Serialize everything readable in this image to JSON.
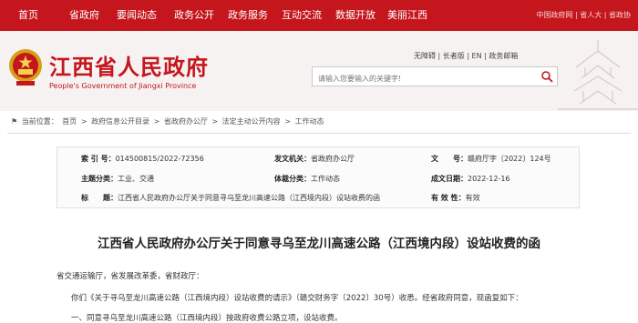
{
  "topnav": {
    "items": [
      "首页",
      "省政府",
      "要闻动态",
      "政务公开",
      "政务服务",
      "互动交流",
      "数据开放",
      "美丽江西"
    ],
    "right_links": "中国政府网 | 省人大 | 省政协"
  },
  "header": {
    "site_name": "江西省人民政府",
    "site_name_en": "People's Government of Jiangxi Province",
    "top_links": "无障碍 | 长者版 | EN | 政务邮箱",
    "search_placeholder": "请输入您要输入的关键字!",
    "emblem_icon": "national-emblem-icon",
    "accent_color": "#c4161c"
  },
  "breadcrumb": {
    "prefix": "当前位置：",
    "items": [
      "首页",
      "政府信息公开目录",
      "省政府办公厅",
      "法定主动公开内容",
      "工作动态"
    ],
    "separator": ">"
  },
  "meta": {
    "index_label": "索 引 号：",
    "index_value": "014500815/2022-72356",
    "publisher_label": "发文机关：",
    "publisher_value": "省政府办公厅",
    "docno_label": "文　　号：",
    "docno_value": "赣府厅字〔2022〕124号",
    "topic_label": "主题分类：",
    "topic_value": "工业、交通",
    "genre_label": "体裁分类：",
    "genre_value": "工作动态",
    "date_label": "成文日期：",
    "date_value": "2022-12-16",
    "title_label": "标　　题：",
    "title_value": "江西省人民政府办公厅关于同意寻乌至龙川高速公路（江西境内段）设站收费的函",
    "validity_label": "有 效 性：",
    "validity_value": "有效"
  },
  "document": {
    "title": "江西省人民政府办公厅关于同意寻乌至龙川高速公路（江西境内段）设站收费的函",
    "addressee": "省交通运输厅，省发展改革委，省财政厅：",
    "para1": "你们《关于寻乌至龙川高速公路（江西境内段）设站收费的请示》（赣交财务字〔2022〕30号）收悉。经省政府同意，现函复如下：",
    "para2": "一、同意寻乌至龙川高速公路（江西境内段）按政府收费公路立项，设站收费。"
  }
}
